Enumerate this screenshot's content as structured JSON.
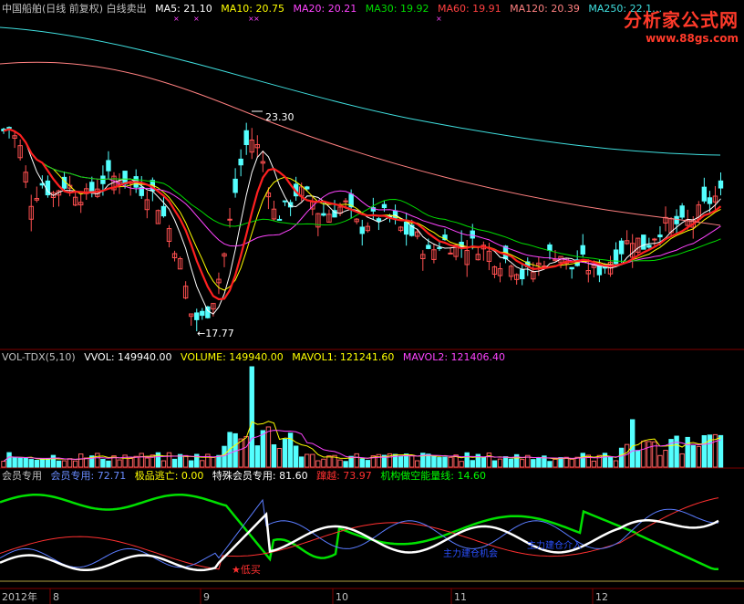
{
  "chart_data": [
    {
      "type": "line",
      "panel": "price",
      "title": "中国船舶(日线 前复权) 白线卖出",
      "indicators": [
        {
          "name": "MA5",
          "label": "MA5: 21.10",
          "color": "#ffffff"
        },
        {
          "name": "MA10",
          "label": "MA10: 20.75",
          "color": "#ffff00"
        },
        {
          "name": "MA20",
          "label": "MA20: 20.21",
          "color": "#ff44ff"
        },
        {
          "name": "MA30",
          "label": "MA30: 19.92",
          "color": "#00dd00"
        },
        {
          "name": "MA60",
          "label": "MA60: 19.91",
          "color": "#ff4040"
        },
        {
          "name": "MA120",
          "label": "MA120: 20.39",
          "color": "#ff8080"
        },
        {
          "name": "MA250",
          "label": "MA250: 22.1…",
          "color": "#40e0e0"
        }
      ],
      "annotations": [
        {
          "text": "23.30",
          "x": "2012-09-05"
        },
        {
          "text": "17.77",
          "x": "2012-08-31"
        }
      ],
      "ylim": [
        17.2,
        26.6
      ]
    },
    {
      "type": "bar",
      "panel": "volume",
      "header": {
        "title": "VOL-TDX(5,10)",
        "vvol": "VVOL: 149940.00",
        "volume": "VOLUME: 149940.00",
        "mavol1": "MAVOL1: 121241.60",
        "mavol2": "MAVOL2: 121406.40"
      }
    },
    {
      "type": "line",
      "panel": "indicator",
      "header": {
        "title": "会员专用",
        "member": "会员专用: 72.71",
        "escape": "极品逃亡: 0.00",
        "special": "特殊会员专用: 81.60",
        "jump": "蹿越: 73.97",
        "inst": "机构做空能量线: 14.60"
      },
      "annotations": {
        "buy": "★低买",
        "l1": "主力建仓机会",
        "l2": "主力建仓介入"
      },
      "ylim": [
        0,
        100
      ]
    }
  ],
  "axis": {
    "year": "2012年",
    "months": [
      "8",
      "9",
      "10",
      "11",
      "12"
    ]
  },
  "watermark": {
    "title": "分析家公式网",
    "url": "www.88gs.com"
  }
}
